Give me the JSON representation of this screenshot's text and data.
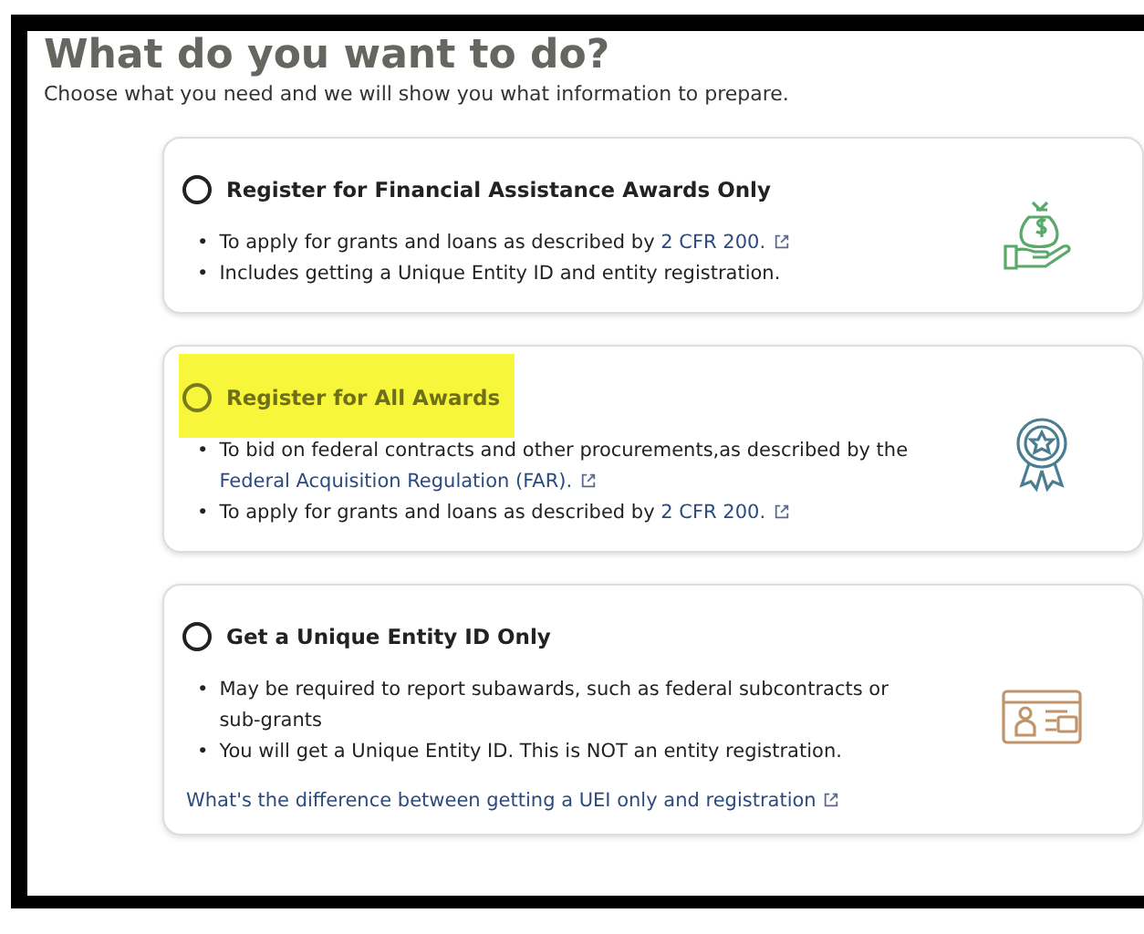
{
  "heading": "What do you want to do?",
  "intro": "Choose what you need and we will show you what information to prepare.",
  "options": [
    {
      "title": "Register for Financial Assistance Awards Only",
      "selected": false,
      "highlighted": false,
      "bullets": [
        {
          "marker": "•",
          "text": "To apply for grants and loans as described by ",
          "link": "2 CFR 200."
        },
        {
          "marker": "•",
          "text": "Includes getting a Unique Entity ID and entity registration."
        }
      ]
    },
    {
      "title": "Register for All Awards",
      "selected": false,
      "highlighted": true,
      "bullets": [
        {
          "marker": "•",
          "text": "To bid on federal contracts and other procurements,as described by the ",
          "link": "Federal Acquisition Regulation (FAR)."
        },
        {
          "marker": "•",
          "text": "To apply for grants and loans as described by ",
          "link": "2 CFR 200."
        }
      ]
    },
    {
      "title": "Get a Unique Entity ID Only",
      "selected": false,
      "highlighted": false,
      "bullets": [
        {
          "marker": "•",
          "text": "May be required to report subawards, such as federal subcontracts or sub-grants"
        },
        {
          "marker": "•",
          "text": "You will get a Unique Entity ID. This is NOT an entity registration."
        }
      ],
      "footer_link": "What's the difference between getting a UEI only and registration"
    }
  ]
}
